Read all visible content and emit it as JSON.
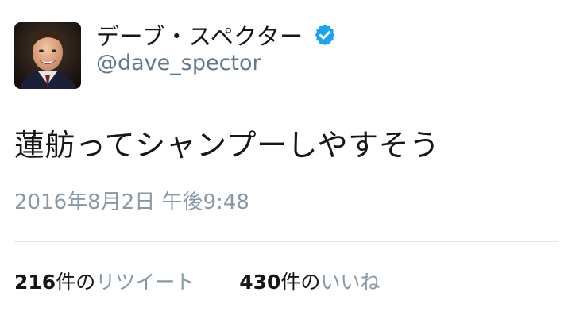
{
  "user": {
    "display_name": "デーブ・スペクター",
    "handle": "@dave_spector",
    "verified_icon": "verified-badge-icon",
    "avatar_icon": "profile-photo"
  },
  "tweet": {
    "text": "蓮舫ってシャンプーしやすそう",
    "timestamp": "2016年8月2日 午後9:48"
  },
  "stats": {
    "retweets": {
      "count": "216",
      "unit": "件の",
      "label": "リツイート"
    },
    "likes": {
      "count": "430",
      "unit": "件の",
      "label": "いいね"
    }
  },
  "colors": {
    "text": "#14171a",
    "secondary": "#657786",
    "muted": "#8899a6",
    "verified": "#1da1f2",
    "divider": "#e1e8ed"
  }
}
